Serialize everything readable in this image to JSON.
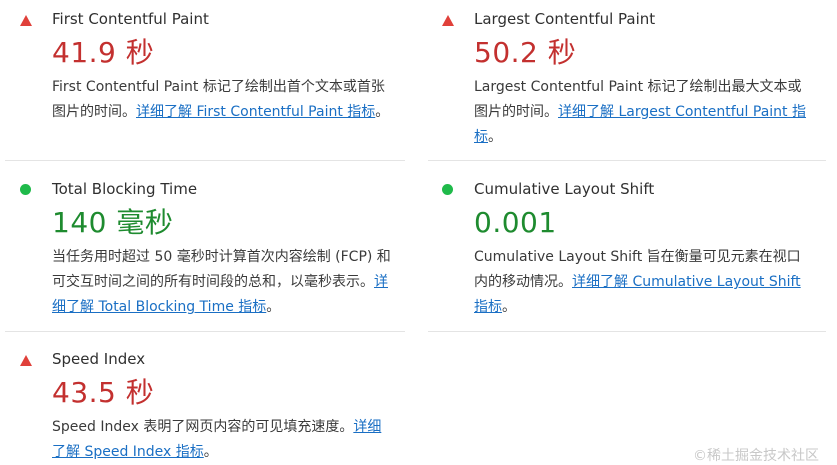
{
  "metrics": {
    "fcp": {
      "title": "First Contentful Paint",
      "value": "41.9 秒",
      "status": "fail",
      "desc": "First Contentful Paint 标记了绘制出首个文本或首张图片的时间。",
      "link": "详细了解 First Contentful Paint 指标",
      "suffix": "。"
    },
    "lcp": {
      "title": "Largest Contentful Paint",
      "value": "50.2 秒",
      "status": "fail",
      "desc": "Largest Contentful Paint 标记了绘制出最大文本或图片的时间。",
      "link": "详细了解 Largest Contentful Paint 指标",
      "suffix": "。"
    },
    "tbt": {
      "title": "Total Blocking Time",
      "value": "140 毫秒",
      "status": "pass",
      "desc": "当任务用时超过 50 毫秒时计算首次内容绘制 (FCP) 和可交互时间之间的所有时间段的总和，以毫秒表示。",
      "link": "详细了解 Total Blocking Time 指标",
      "suffix": "。"
    },
    "cls": {
      "title": "Cumulative Layout Shift",
      "value": "0.001",
      "status": "pass",
      "desc": "Cumulative Layout Shift 旨在衡量可见元素在视口内的移动情况。",
      "link": "详细了解 Cumulative Layout Shift 指标",
      "suffix": "。"
    },
    "si": {
      "title": "Speed Index",
      "value": "43.5 秒",
      "status": "fail",
      "desc": "Speed Index 表明了网页内容的可见填充速度。",
      "link": "详细了解 Speed Index 指标",
      "suffix": "。"
    }
  },
  "colors": {
    "fail": "#c3302f",
    "pass": "#1e8b2f",
    "link": "#1a6fc4"
  },
  "icons": {
    "fail": "warning-triangle-icon",
    "pass": "green-dot-icon"
  },
  "watermark": "©稀土掘金技术社区"
}
